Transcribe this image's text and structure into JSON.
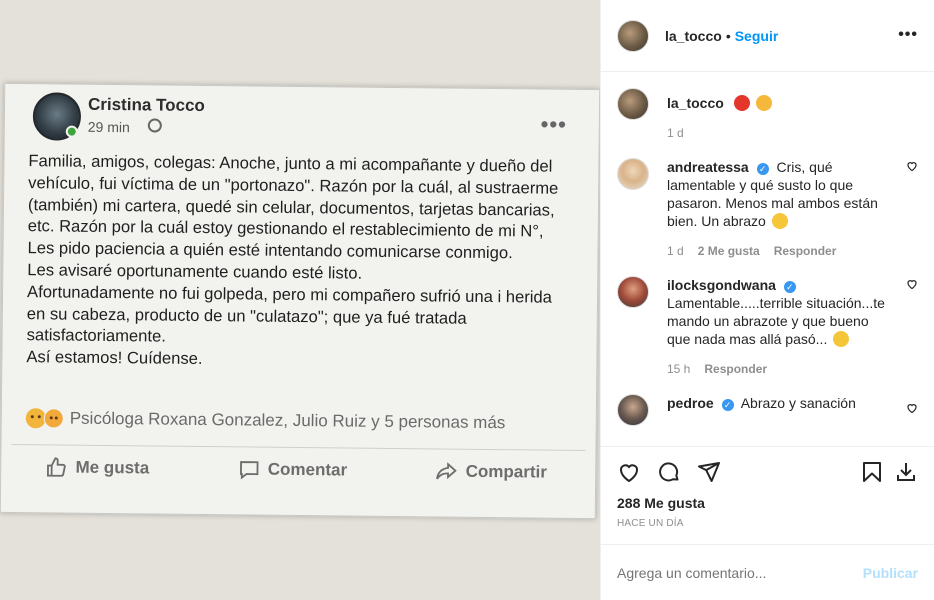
{
  "post_image": {
    "author": "Cristina Tocco",
    "time": "29 min",
    "text": "Familia, amigos, colegas: Anoche, junto a mi acompañante y dueño del vehículo, fui víctima de un \"portonazo\". Razón por la cuál, al sustraerme (también) mi cartera, quedé sin celular, documentos, tarjetas bancarias, etc. Razón por la cuál estoy gestionando el restablecimiento de mi N°,\nLes pido paciencia a quién esté intentando comunicarse conmigo.\nLes avisaré oportunamente cuando esté listo.\nAfortunadamente no fui golpeda, pero mi compañero sufrió una i herida en su cabeza,  producto de un \"culatazo\"; que ya fué tratada satisfactoriamente.\nAsí estamos! Cuídense.",
    "reactions_text": "Psicóloga Roxana Gonzalez, Julio Ruiz y 5 personas más",
    "like_label": "Me gusta",
    "comment_label": "Comentar",
    "share_label": "Compartir"
  },
  "header": {
    "username": "la_tocco",
    "separator": "•",
    "follow_label": "Seguir",
    "more_label": "•••"
  },
  "caption": {
    "username": "la_tocco",
    "time": "1 d"
  },
  "comments": [
    {
      "username": "andreatessa",
      "text": "Cris, qué lamentable y qué susto lo que pasaron. Menos mal ambos están bien. Un abrazo",
      "time": "1 d",
      "likes": "2 Me gusta",
      "reply": "Responder"
    },
    {
      "username": "ilocksgondwana",
      "text": "Lamentable.....terrible situación...te mando un abrazote y que bueno que nada mas allá pasó...",
      "time": "15 h",
      "reply": "Responder"
    },
    {
      "username": "pedroe",
      "text": "Abrazo y sanación"
    }
  ],
  "likes_count": "288 Me gusta",
  "posted_ago": "HACE UN DÍA",
  "add_comment": {
    "placeholder": "Agrega un comentario...",
    "publish_label": "Publicar"
  },
  "colors": {
    "accent": "#0095f6",
    "publish_disabled": "#b2dffc",
    "muted": "#8e8e8e"
  }
}
